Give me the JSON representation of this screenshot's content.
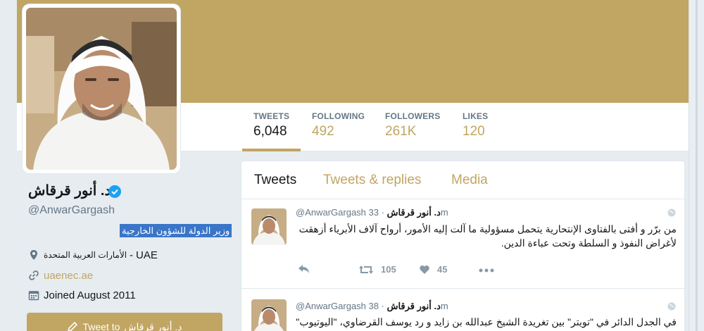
{
  "profile": {
    "name": "د. أنور قرقاش",
    "handle": "@AnwarGargash",
    "bio": "وزير الدولة للشؤون الخارجية",
    "location_en": "UAE",
    "location_sep": "-",
    "location_ar": "الأمارات العربية المتحدة",
    "website": "uaenec.ae",
    "joined": "Joined August 2011",
    "tweet_to_label": "Tweet to",
    "tweet_to_name": "د. أنور قرقاش"
  },
  "stats": [
    {
      "label": "TWEETS",
      "value": "6,048"
    },
    {
      "label": "FOLLOWING",
      "value": "492"
    },
    {
      "label": "FOLLOWERS",
      "value": "261K"
    },
    {
      "label": "LIKES",
      "value": "120"
    }
  ],
  "tabs": [
    "Tweets",
    "Tweets & replies",
    "Media"
  ],
  "tweets": [
    {
      "name": "د. أنور قرقاش",
      "handle": "@AnwarGargash",
      "time": "· 33m",
      "text": "من برّر و أفتى بالفتاوى الإنتحارية يتحمل مسؤولية ما آلت إليه الأمور، أرواح آلاف الأبرياء أزهقت لأغراض النفوذ و السلطة وتحت عباءة الدين.",
      "retweets": "105",
      "likes": "45"
    },
    {
      "name": "د. أنور قرقاش",
      "handle": "@AnwarGargash",
      "time": "· 38m",
      "text": "في الجدل الدائر في \"تويتر\" بين تغريدة الشيخ عبدالله بن زايد و رد يوسف القرضاوي، \"اليوتيوب\" هو",
      "retweets": "",
      "likes": ""
    }
  ],
  "colors": {
    "accent": "#c1a562",
    "verified": "#1da1f2",
    "bio_highlight": "#3a75c8",
    "text_secondary": "#657786"
  },
  "icons": [
    "verified-icon",
    "location-pin-icon",
    "link-icon",
    "calendar-icon",
    "compose-icon",
    "globe-icon",
    "reply-icon",
    "retweet-icon",
    "heart-icon",
    "more-icon"
  ]
}
